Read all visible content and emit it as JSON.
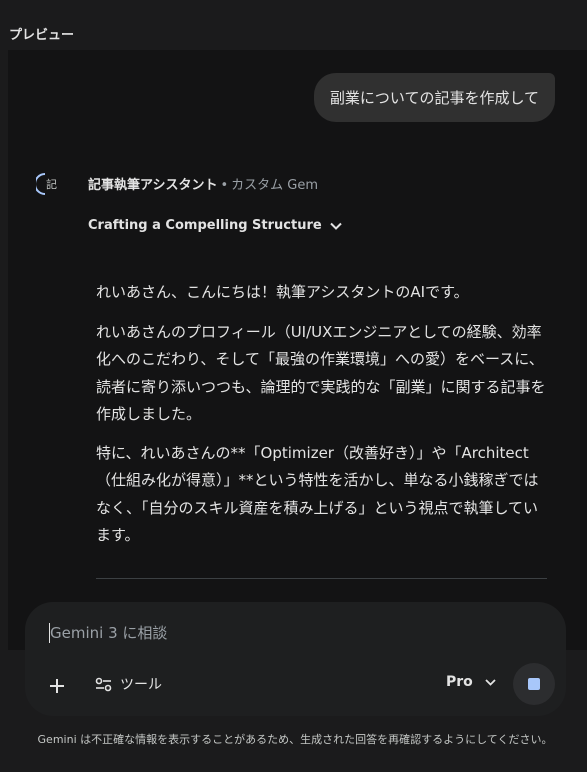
{
  "header": {
    "preview_label": "プレビュー"
  },
  "user_message": {
    "text": "副業についての記事を作成して"
  },
  "assistant": {
    "avatar_text": "記",
    "gem_name": "記事執筆アシスタント",
    "separator": "•",
    "gem_type": "カスタム Gem",
    "thought_title": "Crafting a Compelling Structure",
    "paragraphs": [
      "れいあさん、こんにちは！執筆アシスタントのAIです。",
      "れいあさんのプロフィール（UI/UXエンジニアとしての経験、効率化へのこだわり、そして「最強の作業環境」への愛）をベースに、読者に寄り添いつつも、論理的で実践的な「副業」に関する記事を作成しました。",
      "特に、れいあさんの**「Optimizer（改善好き）」や「Architect（仕組み化が得意）」**という特性を活かし、単なる小銭稼ぎではなく、「自分のスキル資産を積み上げる」という視点で執筆しています。"
    ]
  },
  "composer": {
    "placeholder": "Gemini 3 に相談",
    "tools_label": "ツール",
    "model_label": "Pro"
  },
  "footer": {
    "disclaimer": "Gemini は不正確な情報を表示することがあるため、生成された回答を再確認するようにしてください。"
  },
  "colors": {
    "background": "#1b1b1c",
    "panel": "#131314",
    "bubble": "#303030",
    "accent": "#a8c7fa"
  }
}
